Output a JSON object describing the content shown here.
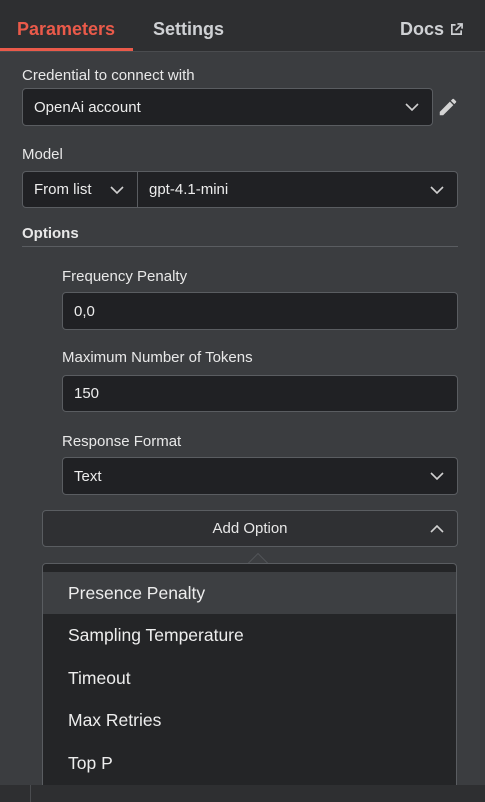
{
  "tabs": {
    "parameters": "Parameters",
    "settings": "Settings",
    "docs": "Docs"
  },
  "credential": {
    "label": "Credential to connect with",
    "value": "OpenAi account"
  },
  "model": {
    "label": "Model",
    "mode": "From list",
    "value": "gpt-4.1-mini"
  },
  "options": {
    "heading": "Options",
    "frequency_penalty": {
      "label": "Frequency Penalty",
      "value": "0,0"
    },
    "max_tokens": {
      "label": "Maximum Number of Tokens",
      "value": "150"
    },
    "response_format": {
      "label": "Response Format",
      "value": "Text"
    },
    "add_option": "Add Option"
  },
  "menu": {
    "items": [
      "Presence Penalty",
      "Sampling Temperature",
      "Timeout",
      "Max Retries",
      "Top P"
    ]
  },
  "colors": {
    "accent": "#ea5a4a",
    "panel": "#3b3d40",
    "input_bg": "#202124"
  }
}
